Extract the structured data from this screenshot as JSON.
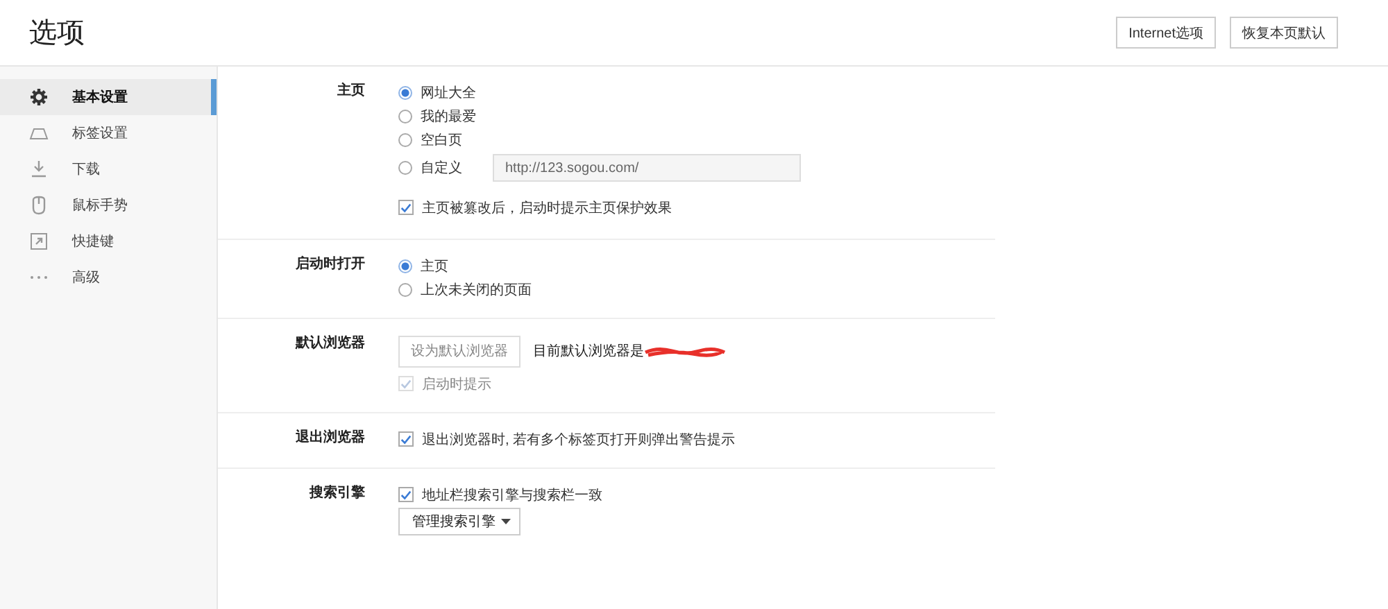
{
  "window": {
    "title": "选项"
  },
  "header_buttons": [
    "Internet选项",
    "恢复本页默认"
  ],
  "sidebar": {
    "items": [
      {
        "label": "基本设置",
        "selected": true
      },
      {
        "label": "标签设置",
        "selected": false
      },
      {
        "label": "下载",
        "selected": false
      },
      {
        "label": "鼠标手势",
        "selected": false
      },
      {
        "label": "快捷键",
        "selected": false
      },
      {
        "label": "高级",
        "selected": false
      }
    ]
  },
  "sections": [
    {
      "label": "主页",
      "items": [
        {
          "kind": "radio",
          "label": "网址大全",
          "selected": true
        },
        {
          "kind": "radio",
          "label": "我的最爱",
          "selected": false
        },
        {
          "kind": "radio",
          "label": "空白页",
          "selected": false
        },
        {
          "kind": "radio",
          "label": "自定义",
          "selected": false,
          "input": {
            "value": "http://123.sogou.com/"
          }
        },
        {
          "kind": "checkbox",
          "label": "主页被篡改后，启动时提示主页保护效果",
          "checked": true,
          "disabled": false
        }
      ]
    },
    {
      "label": "启动时打开",
      "items": [
        {
          "kind": "radio",
          "label": "主页",
          "selected": true
        },
        {
          "kind": "radio",
          "label": "上次未关闭的页面",
          "selected": false
        }
      ]
    },
    {
      "label": "默认浏览器",
      "items": [
        {
          "kind": "button-row",
          "button": "设为默认浏览器",
          "text": "目前默认浏览器是",
          "redacted": true
        },
        {
          "kind": "checkbox",
          "label": "启动时提示",
          "checked": true,
          "disabled": true
        }
      ]
    },
    {
      "label": "退出浏览器",
      "items": [
        {
          "kind": "checkbox",
          "label": "退出浏览器时, 若有多个标签页打开则弹出警告提示",
          "checked": true,
          "disabled": false
        }
      ]
    },
    {
      "label": "搜索引擎",
      "items": [
        {
          "kind": "checkbox",
          "label": "地址栏搜索引擎与搜索栏一致",
          "checked": true,
          "disabled": false
        },
        {
          "kind": "dropdown",
          "label": "管理搜索引擎"
        }
      ]
    }
  ]
}
